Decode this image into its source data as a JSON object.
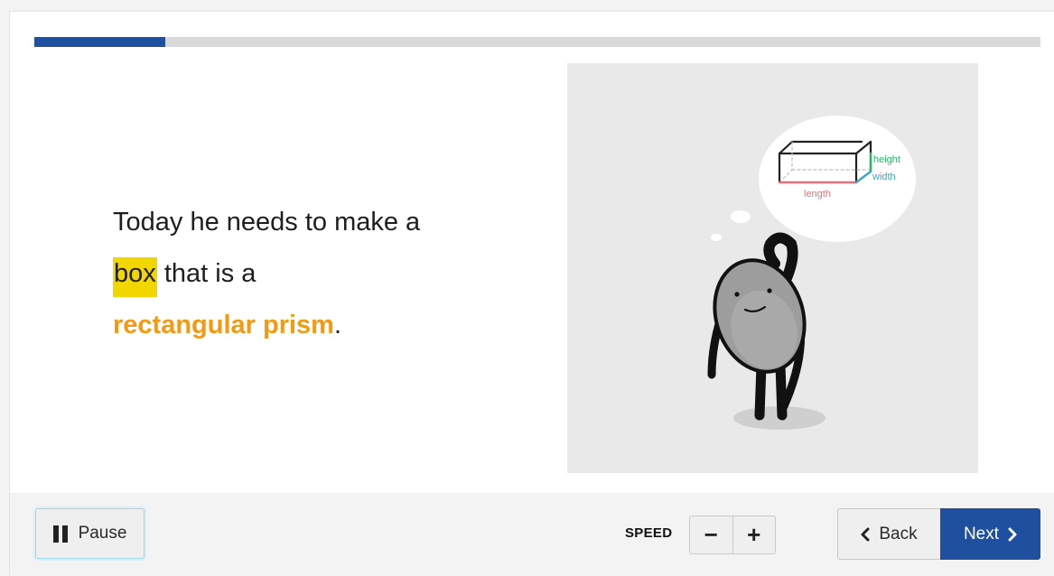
{
  "progress": {
    "fraction": 0.13
  },
  "story": {
    "line1": "Today he needs to make a",
    "highlight_word": "box",
    "line2_rest": " that is a",
    "vocab_term": "rectangular prism",
    "period": "."
  },
  "illustration": {
    "label_height": "height",
    "label_width": "width",
    "label_length": "length"
  },
  "controls": {
    "pause_label": "Pause",
    "speed_label": "SPEED",
    "speed_minus": "−",
    "speed_plus": "+",
    "back_label": "Back",
    "next_label": "Next"
  },
  "colors": {
    "progress": "#1f4f9f",
    "highlight": "#f2d600",
    "vocab": "#f39a12",
    "next_button": "#1f4f9f",
    "height_label": "#2fb36b",
    "width_label": "#3aa7cf",
    "length_label": "#e8707a"
  }
}
